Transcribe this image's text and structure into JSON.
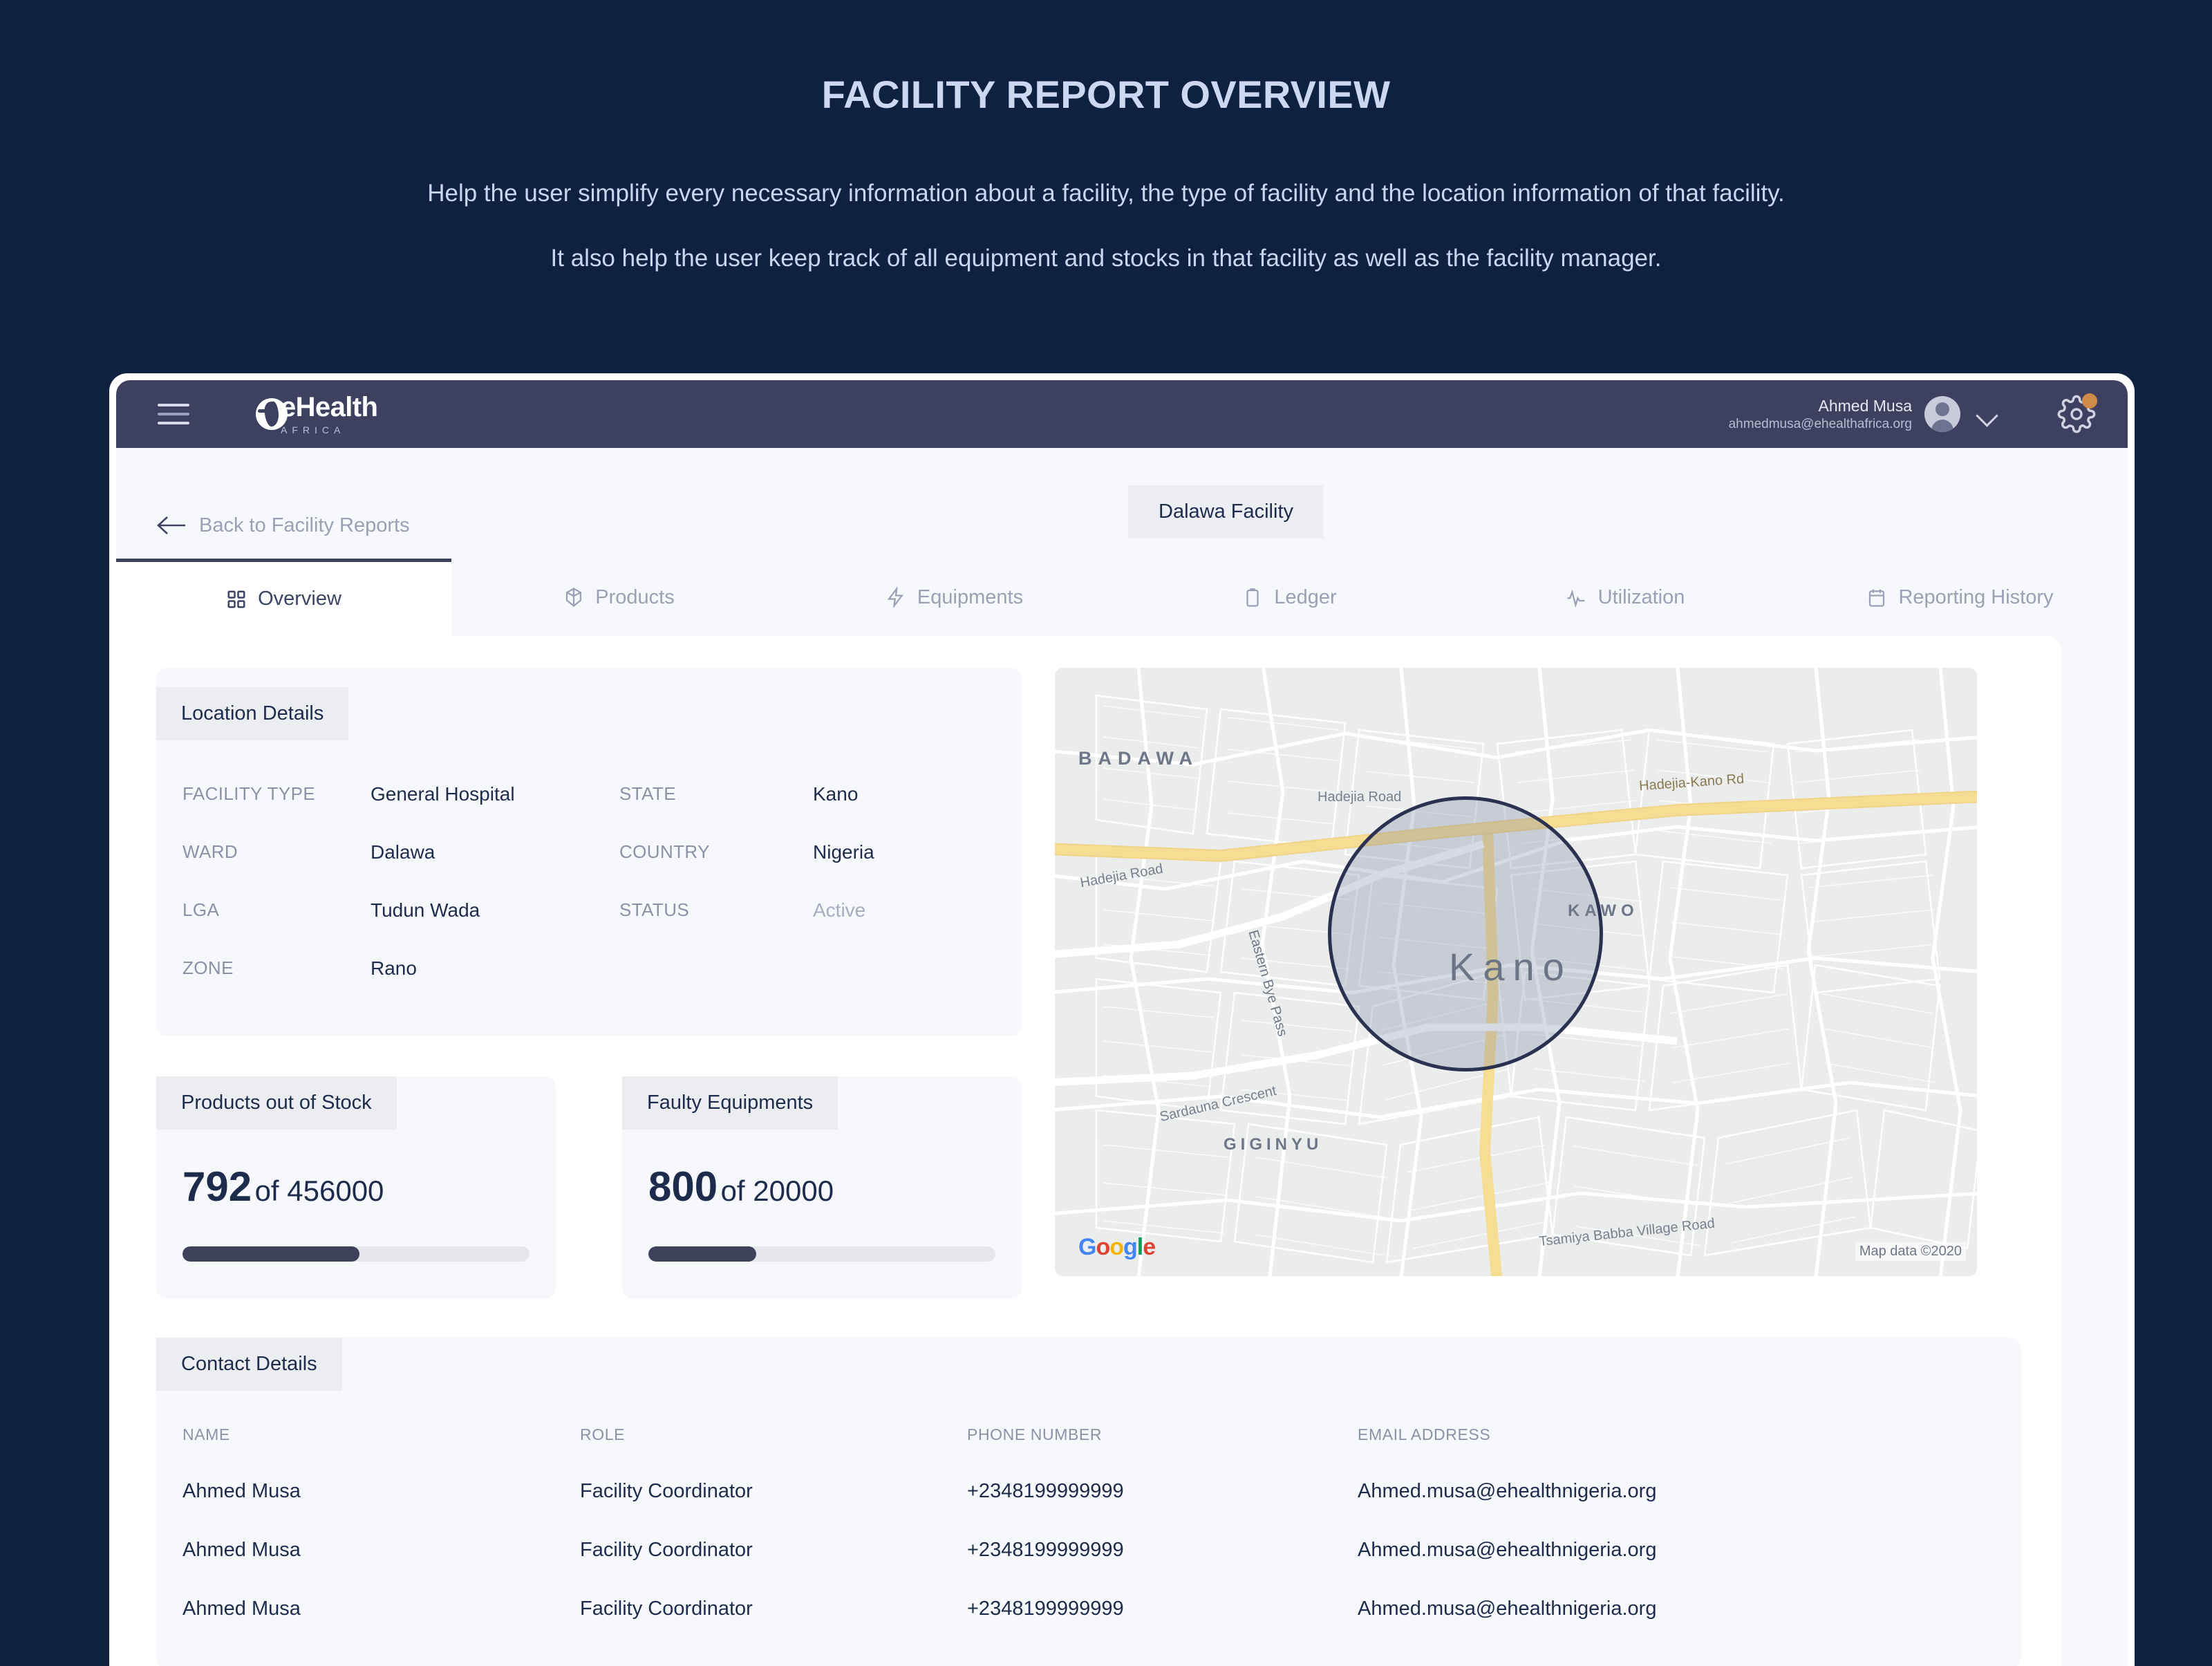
{
  "intro": {
    "title": "FACILITY REPORT OVERVIEW",
    "paragraph1": "Help the user simplify every necessary information about a facility, the type of facility and the location information of that facility.",
    "paragraph2": "It also help the user keep track of  all equipment and stocks in that facility as well as the facility manager."
  },
  "navbar": {
    "logo_name": "eHealth",
    "logo_sub": "AFRICA",
    "user_name": "Ahmed Musa",
    "user_email": "ahmedmusa@ehealthafrica.org"
  },
  "page_head": {
    "back_label": "Back to Facility Reports",
    "facility_chip": "Dalawa Facility"
  },
  "tabs": [
    {
      "label": "Overview",
      "icon": "grid-icon",
      "active": true
    },
    {
      "label": "Products",
      "icon": "box-icon",
      "active": false
    },
    {
      "label": "Equipments",
      "icon": "bolt-icon",
      "active": false
    },
    {
      "label": "Ledger",
      "icon": "clipboard-icon",
      "active": false
    },
    {
      "label": "Utilization",
      "icon": "pulse-icon",
      "active": false
    },
    {
      "label": "Reporting History",
      "icon": "calendar-icon",
      "active": false
    }
  ],
  "location_details": {
    "title": "Location Details",
    "fields": [
      {
        "key": "FACILITY TYPE",
        "value": "General Hospital"
      },
      {
        "key": "STATE",
        "value": "Kano"
      },
      {
        "key": "WARD",
        "value": "Dalawa"
      },
      {
        "key": "COUNTRY",
        "value": "Nigeria"
      },
      {
        "key": "LGA",
        "value": "Tudun Wada"
      },
      {
        "key": "STATUS",
        "value": "Active"
      },
      {
        "key": "ZONE",
        "value": "Rano"
      },
      {
        "key": "",
        "value": ""
      }
    ]
  },
  "stats": [
    {
      "title": "Products out of Stock",
      "value": "792",
      "of": "of 456000",
      "percent": 51
    },
    {
      "title": "Faulty Equipments",
      "value": "800",
      "of": "of 20000",
      "percent": 31
    }
  ],
  "map": {
    "place_badawa": "BADAWA",
    "place_kawo": "KAWO",
    "place_kano": "Kano",
    "place_giginyu": "GIGINYU",
    "road_hadejia_1": "Hadejia Road",
    "road_hadejia_2": "Hadejia Road",
    "road_hadejia_kano": "Hadejia-Kano Rd",
    "road_eastern_bye_pass": "Eastern Bye Pass",
    "road_sardauna": "Sardauna Crescent",
    "road_tsamiya": "Tsamiya Babba Village Road",
    "attribution": "Map data ©2020",
    "brand": "Google"
  },
  "contact_details": {
    "title": "Contact Details",
    "columns": [
      "NAME",
      "ROLE",
      "PHONE NUMBER",
      "EMAIL ADDRESS"
    ],
    "rows": [
      {
        "name": "Ahmed Musa",
        "role": "Facility Coordinator",
        "phone": "+2348199999999",
        "email": "Ahmed.musa@ehealthnigeria.org"
      },
      {
        "name": "Ahmed Musa",
        "role": "Facility Coordinator",
        "phone": "+2348199999999",
        "email": "Ahmed.musa@ehealthnigeria.org"
      },
      {
        "name": "Ahmed Musa",
        "role": "Facility Coordinator",
        "phone": "+2348199999999",
        "email": "Ahmed.musa@ehealthnigeria.org"
      }
    ]
  },
  "colors": {
    "page_bg": "#0f2140",
    "navbar": "#3d405f",
    "accent_dark": "#3d4159",
    "notification_dot": "#d08a4a",
    "text_dark": "#1d2b4d",
    "text_muted": "#8a92a8"
  }
}
